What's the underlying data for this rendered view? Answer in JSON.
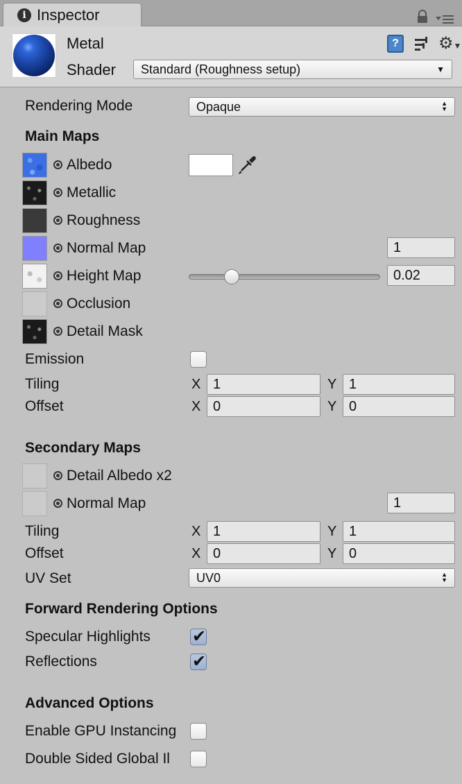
{
  "tab": {
    "title": "Inspector"
  },
  "icons": {
    "info": "i",
    "help": "?",
    "gear": "⚙",
    "eyedropper": "eyedropper-icon",
    "lock": "lock-icon",
    "menu": "menu-icon"
  },
  "header": {
    "material_name": "Metal",
    "shader_label": "Shader",
    "shader_value": "Standard (Roughness setup)"
  },
  "rendering_mode": {
    "label": "Rendering Mode",
    "value": "Opaque"
  },
  "main_maps": {
    "title": "Main Maps",
    "albedo": {
      "label": "Albedo",
      "color": "#ffffff"
    },
    "metallic": {
      "label": "Metallic"
    },
    "roughness": {
      "label": "Roughness"
    },
    "normal_map": {
      "label": "Normal Map",
      "value": "1"
    },
    "height_map": {
      "label": "Height Map",
      "value": "0.02",
      "slider_fraction": 0.2
    },
    "occlusion": {
      "label": "Occlusion"
    },
    "detail_mask": {
      "label": "Detail Mask"
    },
    "emission": {
      "label": "Emission",
      "checked": false
    },
    "tiling": {
      "label": "Tiling",
      "x_label": "X",
      "x": "1",
      "y_label": "Y",
      "y": "1"
    },
    "offset": {
      "label": "Offset",
      "x_label": "X",
      "x": "0",
      "y_label": "Y",
      "y": "0"
    }
  },
  "secondary_maps": {
    "title": "Secondary Maps",
    "detail_albedo": {
      "label": "Detail Albedo x2"
    },
    "normal_map": {
      "label": "Normal Map",
      "value": "1"
    },
    "tiling": {
      "label": "Tiling",
      "x_label": "X",
      "x": "1",
      "y_label": "Y",
      "y": "1"
    },
    "offset": {
      "label": "Offset",
      "x_label": "X",
      "x": "0",
      "y_label": "Y",
      "y": "0"
    },
    "uv_set": {
      "label": "UV Set",
      "value": "UV0"
    }
  },
  "forward_rendering": {
    "title": "Forward Rendering Options",
    "specular_highlights": {
      "label": "Specular Highlights",
      "checked": true
    },
    "reflections": {
      "label": "Reflections",
      "checked": true
    }
  },
  "advanced": {
    "title": "Advanced Options",
    "gpu_instancing": {
      "label": "Enable GPU Instancing",
      "checked": false
    },
    "double_sided_gi": {
      "label": "Double Sided Global Il",
      "checked": false
    }
  },
  "colors": {
    "panel": "#c2c2c2",
    "header": "#d6d6d6",
    "help_blue": "#4d86c8"
  }
}
